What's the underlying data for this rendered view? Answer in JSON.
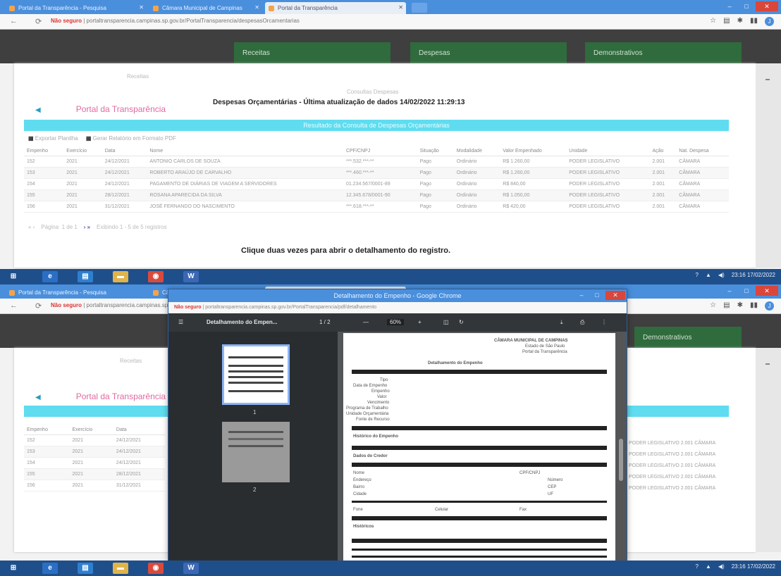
{
  "browser": {
    "tabs": [
      {
        "label": "Portal da Transparência - Pesquisa",
        "active": false
      },
      {
        "label": "Câmara Municipal de Campinas",
        "active": false
      },
      {
        "label": "Portal da Transparência",
        "active": true
      }
    ],
    "url_warning": "Não seguro",
    "url": "portaltransparencia.campinas.sp.gov.br/PortalTransparencia/despesasOrcamentarias",
    "window_controls": {
      "min": "–",
      "max": "□",
      "close": "✕"
    },
    "avatar_letter": "J"
  },
  "site": {
    "nav_buttons": [
      "Receitas",
      "Despesas",
      "Demonstrativos"
    ],
    "faint_top": "Receitas",
    "faint_center": "Consultas    Despesas",
    "heading": "Despesas Orçamentárias - Última atualização de dados 14/02/2022 11:29:13",
    "brand": "Portal da Transparência",
    "detail_bar": "Resultado da Consulta de Despesas Orçamentárias",
    "tools": [
      "Exportar Planilha",
      "Gerar Relatório em Formato PDF"
    ],
    "columns": [
      "Empenho",
      "Exercício",
      "Data",
      "Nome",
      "CPF/CNPJ",
      "Situação",
      "Modalidade",
      "Valor Empenhado",
      "Unidade",
      "Ação",
      "Nat. Despesa"
    ],
    "rows": [
      [
        "152",
        "2021",
        "24/12/2021",
        "ANTONIO CARLOS DE SOUZA",
        "***.532.***-**",
        "Pago",
        "Ordinário",
        "R$ 1.260,00",
        "PODER LEGISLATIVO",
        "2.001",
        "CÂMARA"
      ],
      [
        "153",
        "2021",
        "24/12/2021",
        "ROBERTO ARAÚJO DE CARVALHO",
        "***.460.***-**",
        "Pago",
        "Ordinário",
        "R$ 1.260,00",
        "PODER LEGISLATIVO",
        "2.001",
        "CÂMARA"
      ],
      [
        "154",
        "2021",
        "24/12/2021",
        "PAGAMENTO DE DIÁRIAS DE VIAGEM A SERVIDORES",
        "01.234.567/0001-89",
        "Pago",
        "Ordinário",
        "R$ 840,00",
        "PODER LEGISLATIVO",
        "2.001",
        "CÂMARA"
      ],
      [
        "155",
        "2021",
        "28/12/2021",
        "ROSANA APARECIDA DA SILVA",
        "12.345.678/0001-90",
        "Pago",
        "Ordinário",
        "R$ 1.050,00",
        "PODER LEGISLATIVO",
        "2.001",
        "CÂMARA"
      ],
      [
        "156",
        "2021",
        "31/12/2021",
        "JOSÉ FERNANDO DO NASCIMENTO",
        "***.618.***-**",
        "Pago",
        "Ordinário",
        "R$ 420,00",
        "PODER LEGISLATIVO",
        "2.001",
        "CÂMARA"
      ]
    ],
    "pager": {
      "prev": "« ‹",
      "page": "Página",
      "of": "1 de 1",
      "next": "› »",
      "info": "Exibindo 1 - 5 de 5 registros"
    },
    "bottom_msg": "Clique duas vezes para abrir o detalhamento do registro."
  },
  "taskbar": {
    "icons": [
      "⊞",
      "e",
      "▤",
      "▬",
      "◉",
      "W"
    ],
    "time": "23:16",
    "date": "17/02/2022"
  },
  "pdf": {
    "window_title": "Detalhamento do Empenho - Google Chrome",
    "url": "portaltransparencia.campinas.sp.gov.br/PortalTransparencia/pdf/detalhamento",
    "doc_title": "Detalhamento do Empen...",
    "page_counter": "1 / 2",
    "zoom_minus": "—",
    "zoom": "60%",
    "zoom_plus": "+",
    "thumb_nums": [
      "1",
      "2"
    ],
    "header_lines": [
      "CÂMARA MUNICIPAL DE CAMPINAS",
      "Estado de São Paulo",
      "Portal da Transparência",
      "Detalhamento do Empenho"
    ],
    "fields": [
      "Tipo",
      "Data de Empenho",
      "Empenho",
      "Valor",
      "Vencimento",
      "Programa de Trabalho",
      "Unidade Orçamentária",
      "Fonte de Recurso"
    ],
    "section_labels": [
      "Histórico do Empenho",
      "Dados do Credor",
      "Nome",
      "Endereço",
      "Bairro",
      "Cidade",
      "Fone",
      "Celular",
      "Fax",
      "Históricos"
    ],
    "side_labels": [
      "CPF/CNPJ",
      "Número",
      "CEP",
      "UF"
    ]
  },
  "right_strip": [
    "PODER LEGISLATIVO  2.001  CÂMARA",
    "PODER LEGISLATIVO  2.001  CÂMARA",
    "PODER LEGISLATIVO  2.001  CÂMARA",
    "PODER LEGISLATIVO  2.001  CÂMARA",
    "PODER LEGISLATIVO  2.001  CÂMARA"
  ],
  "colors": {
    "tabstrip": "#4a8fdc",
    "nav_green": "#2f6b3c",
    "detail_bar": "#5fdcf0",
    "brand": "#e06aa0",
    "taskbar": "#1f4f8a"
  }
}
